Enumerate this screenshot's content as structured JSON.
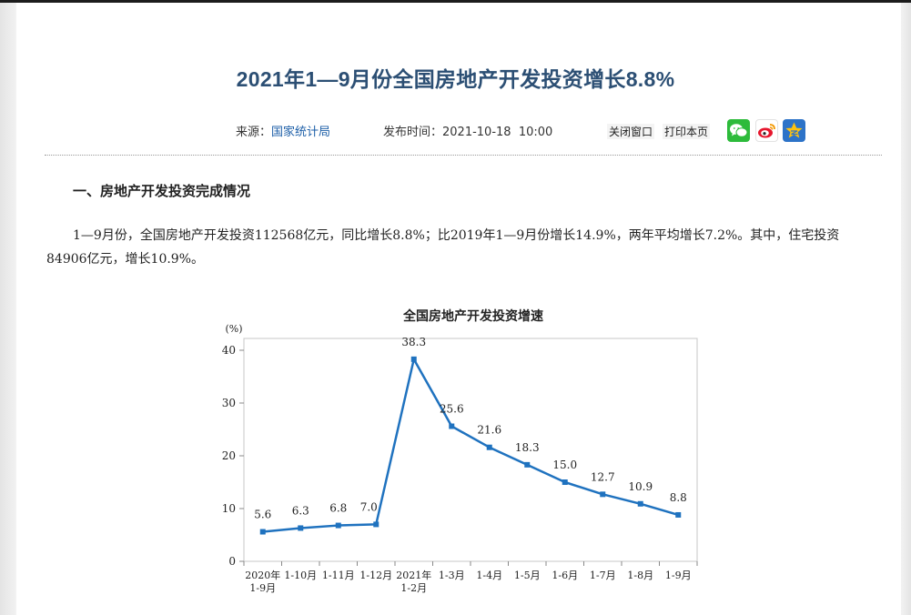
{
  "article": {
    "title": "2021年1—9月份全国房地产开发投资增长8.8%",
    "source_label": "来源：",
    "source_value": "国家统计局",
    "publish_label": "发布时间：",
    "publish_time": "2021-10-18  10:00",
    "close_window": "关闭窗口",
    "print_page": "打印本页",
    "section_heading": "一、房地产开发投资完成情况",
    "paragraph": "1—9月份，全国房地产开发投资112568亿元，同比增长8.8%；比2019年1—9月份增长14.9%，两年平均增长7.2%。其中，住宅投资84906亿元，增长10.9%。"
  },
  "share_icons": [
    "wechat-icon",
    "weibo-icon",
    "qzone-icon"
  ],
  "colors": {
    "title": "#2c4f74",
    "line": "#1f72bf",
    "wechat": "#2dbb3b",
    "qzone": "#2d73c8"
  },
  "chart_data": {
    "type": "line",
    "title": "全国房地产开发投资增速",
    "ylabel": "(%)",
    "ylim": [
      0,
      40
    ],
    "yticks": [
      0,
      10,
      20,
      30,
      40
    ],
    "categories": [
      [
        "2020年",
        "1-9月"
      ],
      [
        "1-10月"
      ],
      [
        "1-11月"
      ],
      [
        "1-12月"
      ],
      [
        "2021年",
        "1-2月"
      ],
      [
        "1-3月"
      ],
      [
        "1-4月"
      ],
      [
        "1-5月"
      ],
      [
        "1-6月"
      ],
      [
        "1-7月"
      ],
      [
        "1-8月"
      ],
      [
        "1-9月"
      ]
    ],
    "values": [
      5.6,
      6.3,
      6.8,
      7.0,
      38.3,
      25.6,
      21.6,
      18.3,
      15.0,
      12.7,
      10.9,
      8.8
    ],
    "data_labels": [
      "5.6",
      "6.3",
      "6.8",
      "7.0",
      "38.3",
      "25.6",
      "21.6",
      "18.3",
      "15.0",
      "12.7",
      "10.9",
      "8.8"
    ],
    "grid": false,
    "legend": "none"
  }
}
